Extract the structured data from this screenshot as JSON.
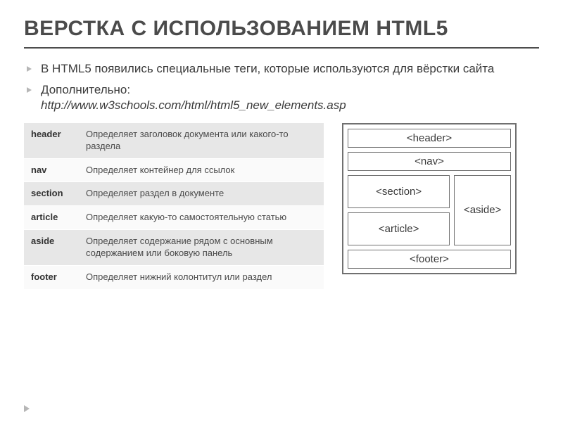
{
  "title": "ВЕРСТКА С ИСПОЛЬЗОВАНИЕМ HTML5",
  "bullet1": "В HTML5 появились специальные  теги, которые используются для вёрстки сайта",
  "bullet2_label": "Дополнительно:",
  "bullet2_value": "http://www.w3schools.com/html/html5_new_elements.asp",
  "table": {
    "rows": [
      {
        "tag": "header",
        "desc": "Определяет заголовок документа или какого-то раздела"
      },
      {
        "tag": "nav",
        "desc": "Определяет контейнер для ссылок"
      },
      {
        "tag": "section",
        "desc": "Определяет раздел в документе"
      },
      {
        "tag": "article",
        "desc": "Определяет какую-то самостоятельную статью"
      },
      {
        "tag": "aside",
        "desc": "Определяет содержание рядом с основным содержанием или боковую панель"
      },
      {
        "tag": "footer",
        "desc": "Определяет  нижний колонтитул или раздел"
      }
    ]
  },
  "diagram": {
    "header": "<header>",
    "nav": "<nav>",
    "section": "<section>",
    "article": "<article>",
    "aside": "<aside>",
    "footer": "<footer>"
  }
}
